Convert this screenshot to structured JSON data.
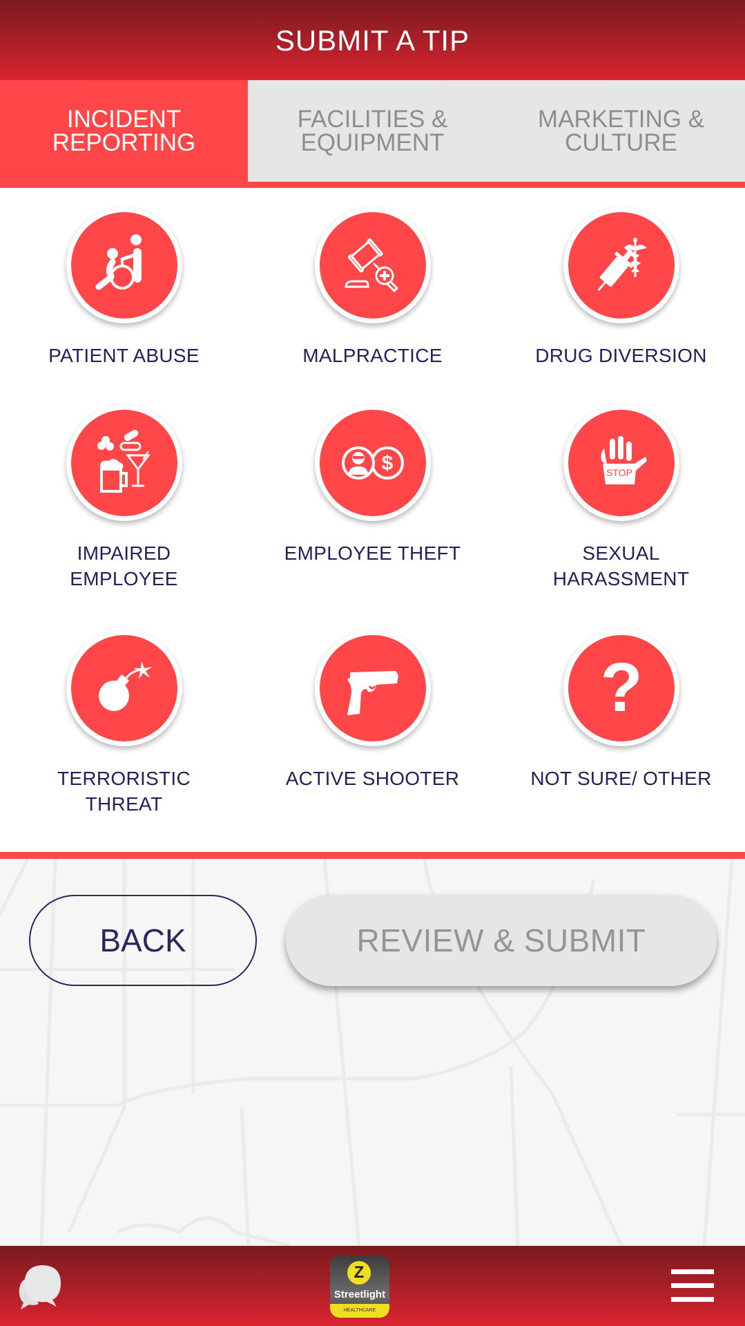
{
  "header": {
    "title": "SUBMIT A TIP"
  },
  "tabs": [
    {
      "label": "INCIDENT\nREPORTING",
      "active": true
    },
    {
      "label": "FACILITIES &\nEQUIPMENT",
      "active": false
    },
    {
      "label": "MARKETING &\nCULTURE",
      "active": false
    }
  ],
  "categories": [
    {
      "label": "PATIENT ABUSE",
      "icon": "wheelchair-caregiver-icon"
    },
    {
      "label": "MALPRACTICE",
      "icon": "gavel-medical-icon"
    },
    {
      "label": "DRUG DIVERSION",
      "icon": "syringe-caduceus-icon"
    },
    {
      "label": "IMPAIRED\nEMPLOYEE",
      "icon": "pills-alcohol-icon"
    },
    {
      "label": "EMPLOYEE THEFT",
      "icon": "thief-dollar-icon"
    },
    {
      "label": "SEXUAL\nHARASSMENT",
      "icon": "stop-hand-icon"
    },
    {
      "label": "TERRORISTIC\nTHREAT",
      "icon": "bomb-icon"
    },
    {
      "label": "ACTIVE SHOOTER",
      "icon": "handgun-icon"
    },
    {
      "label": "NOT SURE/ OTHER",
      "icon": "question-mark-icon"
    }
  ],
  "buttons": {
    "back": "BACK",
    "review_submit": "REVIEW & SUBMIT"
  },
  "footer": {
    "chat_icon": "chat-bubbles-icon",
    "logo_letter": "Z",
    "logo_name": "Streetlight",
    "logo_sub": "HEALTHCARE",
    "menu_icon": "hamburger-menu-icon"
  },
  "colors": {
    "accent": "#ff4648",
    "header_dark": "#7a1a1f",
    "header_light": "#dc2431",
    "label_text": "#24205a",
    "tab_inactive_bg": "#e6e6e6",
    "tab_inactive_text": "#8e8e8e"
  }
}
